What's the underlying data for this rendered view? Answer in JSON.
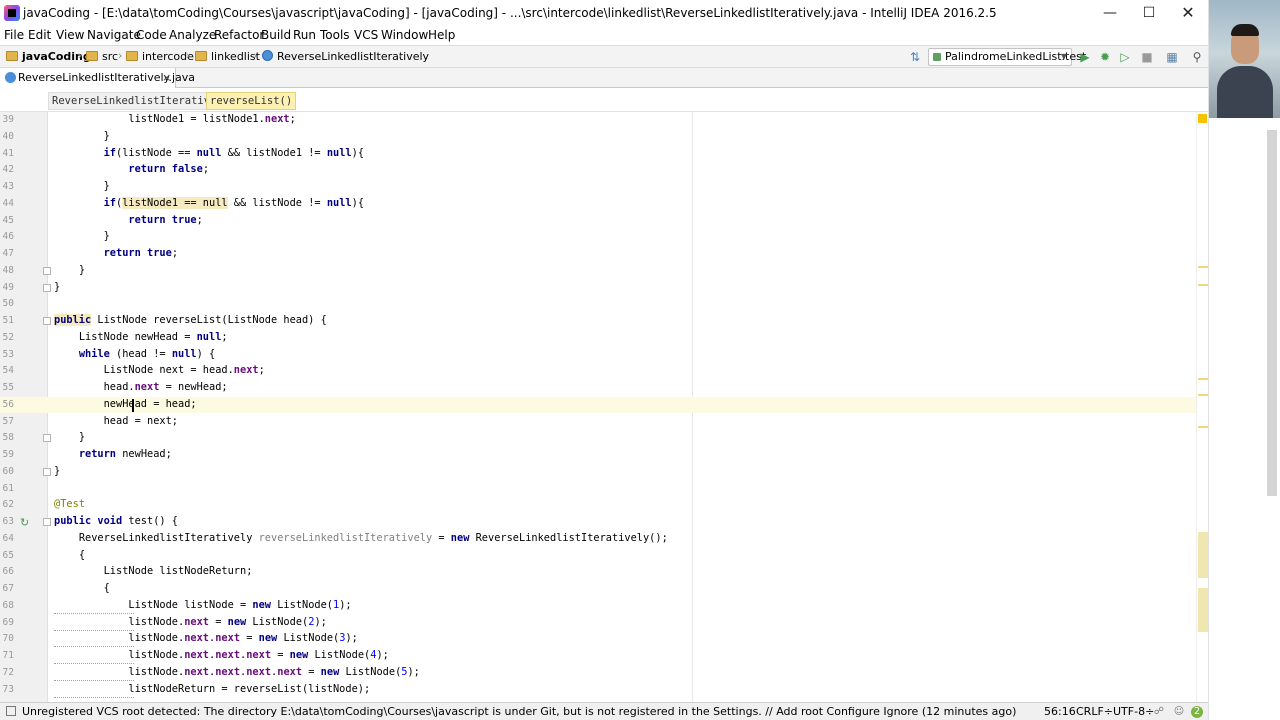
{
  "window": {
    "title": "javaCoding - [E:\\data\\tomCoding\\Courses\\javascript\\javaCoding] - [javaCoding] - ...\\src\\intercode\\linkedlist\\ReverseLinkedlistIteratively.java - IntelliJ IDEA 2016.2.5"
  },
  "menu": [
    "File",
    "Edit",
    "View",
    "Navigate",
    "Code",
    "Analyze",
    "Refactor",
    "Build",
    "Run",
    "Tools",
    "VCS",
    "Window",
    "Help"
  ],
  "nav": {
    "project": "javaCoding",
    "crumbs": [
      "src",
      "intercode",
      "linkedlist",
      "ReverseLinkedlistIteratively"
    ],
    "run_config": "PalindromeLinkedList.test"
  },
  "tabs": [
    {
      "label": "ReverseLinkedlistIteratively.java",
      "close": "×"
    }
  ],
  "breadcrumbs": {
    "class": "ReverseLinkedlistIteratively",
    "method": "reverseList()"
  },
  "lines": [
    {
      "n": "39",
      "indent": "            ",
      "segs": [
        [
          "t",
          "listNode1 = listNode1."
        ],
        [
          "f",
          "next"
        ],
        [
          "t",
          ";"
        ]
      ]
    },
    {
      "n": "40",
      "indent": "        ",
      "segs": [
        [
          "t",
          "}"
        ]
      ]
    },
    {
      "n": "41",
      "indent": "        ",
      "segs": [
        [
          "k",
          "if"
        ],
        [
          "t",
          "(listNode == "
        ],
        [
          "k",
          "null"
        ],
        [
          "t",
          " && listNode1 != "
        ],
        [
          "k",
          "null"
        ],
        [
          "t",
          "){"
        ]
      ]
    },
    {
      "n": "42",
      "indent": "            ",
      "segs": [
        [
          "k",
          "return false"
        ],
        [
          "t",
          ";"
        ]
      ]
    },
    {
      "n": "43",
      "indent": "        ",
      "segs": [
        [
          "t",
          "}"
        ]
      ]
    },
    {
      "n": "44",
      "indent": "        ",
      "segs": [
        [
          "k",
          "if"
        ],
        [
          "t",
          "("
        ],
        [
          "h",
          "listNode1 == null"
        ],
        [
          "t",
          " && listNode != "
        ],
        [
          "k",
          "null"
        ],
        [
          "t",
          "){"
        ]
      ]
    },
    {
      "n": "45",
      "indent": "            ",
      "segs": [
        [
          "k",
          "return true"
        ],
        [
          "t",
          ";"
        ]
      ]
    },
    {
      "n": "46",
      "indent": "        ",
      "segs": [
        [
          "t",
          "}"
        ]
      ]
    },
    {
      "n": "47",
      "indent": "        ",
      "segs": [
        [
          "k",
          "return true"
        ],
        [
          "t",
          ";"
        ]
      ]
    },
    {
      "n": "48",
      "indent": "    ",
      "segs": [
        [
          "t",
          "}"
        ]
      ]
    },
    {
      "n": "49",
      "indent": "",
      "segs": [
        [
          "t",
          "}"
        ]
      ]
    },
    {
      "n": "50",
      "indent": "",
      "segs": []
    },
    {
      "n": "51",
      "indent": "",
      "segs": [
        [
          "hk",
          "public"
        ],
        [
          "t",
          " ListNode reverseList(ListNode head) {"
        ]
      ]
    },
    {
      "n": "52",
      "indent": "    ",
      "segs": [
        [
          "t",
          "ListNode newHead = "
        ],
        [
          "k",
          "null"
        ],
        [
          "t",
          ";"
        ]
      ]
    },
    {
      "n": "53",
      "indent": "    ",
      "segs": [
        [
          "k",
          "while"
        ],
        [
          "t",
          " (head != "
        ],
        [
          "k",
          "null"
        ],
        [
          "t",
          ") {"
        ]
      ]
    },
    {
      "n": "54",
      "indent": "        ",
      "segs": [
        [
          "t",
          "ListNode next = head."
        ],
        [
          "f",
          "next"
        ],
        [
          "t",
          ";"
        ]
      ]
    },
    {
      "n": "55",
      "indent": "        ",
      "segs": [
        [
          "t",
          "head."
        ],
        [
          "f",
          "next"
        ],
        [
          "t",
          " = newHead;"
        ]
      ]
    },
    {
      "n": "56",
      "indent": "        ",
      "segs": [
        [
          "t",
          "newHead = head;"
        ]
      ]
    },
    {
      "n": "57",
      "indent": "        ",
      "segs": [
        [
          "t",
          "head = next;"
        ]
      ]
    },
    {
      "n": "58",
      "indent": "    ",
      "segs": [
        [
          "t",
          "}"
        ]
      ]
    },
    {
      "n": "59",
      "indent": "    ",
      "segs": [
        [
          "k",
          "return"
        ],
        [
          "t",
          " newHead;"
        ]
      ]
    },
    {
      "n": "60",
      "indent": "",
      "segs": [
        [
          "t",
          "}"
        ]
      ]
    },
    {
      "n": "61",
      "indent": "",
      "segs": []
    },
    {
      "n": "62",
      "indent": "",
      "segs": [
        [
          "a",
          "@Test"
        ]
      ]
    },
    {
      "n": "63",
      "indent": "",
      "segs": [
        [
          "k",
          "public void"
        ],
        [
          "t",
          " test() {"
        ]
      ]
    },
    {
      "n": "64",
      "indent": "    ",
      "segs": [
        [
          "t",
          "ReverseLinkedlistIteratively "
        ],
        [
          "u",
          "reverseLinkedlistIteratively"
        ],
        [
          "t",
          " = "
        ],
        [
          "k",
          "new"
        ],
        [
          "t",
          " ReverseLinkedlistIteratively();"
        ]
      ]
    },
    {
      "n": "65",
      "indent": "    ",
      "segs": [
        [
          "t",
          "{"
        ]
      ]
    },
    {
      "n": "66",
      "indent": "        ",
      "segs": [
        [
          "t",
          "ListNode listNodeReturn;"
        ]
      ]
    },
    {
      "n": "67",
      "indent": "        ",
      "segs": [
        [
          "t",
          "{"
        ]
      ]
    },
    {
      "n": "68",
      "indent": "            ",
      "segs": [
        [
          "t",
          "ListNode listNode = "
        ],
        [
          "k",
          "new"
        ],
        [
          "t",
          " ListNode("
        ],
        [
          "n",
          "1"
        ],
        [
          "t",
          ");"
        ]
      ]
    },
    {
      "n": "69",
      "indent": "            ",
      "segs": [
        [
          "t",
          "listNode."
        ],
        [
          "f",
          "next"
        ],
        [
          "t",
          " = "
        ],
        [
          "k",
          "new"
        ],
        [
          "t",
          " ListNode("
        ],
        [
          "n",
          "2"
        ],
        [
          "t",
          ");"
        ]
      ]
    },
    {
      "n": "70",
      "indent": "            ",
      "segs": [
        [
          "t",
          "listNode."
        ],
        [
          "f",
          "next"
        ],
        [
          "t",
          "."
        ],
        [
          "f",
          "next"
        ],
        [
          "t",
          " = "
        ],
        [
          "k",
          "new"
        ],
        [
          "t",
          " ListNode("
        ],
        [
          "n",
          "3"
        ],
        [
          "t",
          ");"
        ]
      ]
    },
    {
      "n": "71",
      "indent": "            ",
      "segs": [
        [
          "t",
          "listNode."
        ],
        [
          "f",
          "next"
        ],
        [
          "t",
          "."
        ],
        [
          "f",
          "next"
        ],
        [
          "t",
          "."
        ],
        [
          "f",
          "next"
        ],
        [
          "t",
          " = "
        ],
        [
          "k",
          "new"
        ],
        [
          "t",
          " ListNode("
        ],
        [
          "n",
          "4"
        ],
        [
          "t",
          ");"
        ]
      ]
    },
    {
      "n": "72",
      "indent": "            ",
      "segs": [
        [
          "t",
          "listNode."
        ],
        [
          "f",
          "next"
        ],
        [
          "t",
          "."
        ],
        [
          "f",
          "next"
        ],
        [
          "t",
          "."
        ],
        [
          "f",
          "next"
        ],
        [
          "t",
          "."
        ],
        [
          "f",
          "next"
        ],
        [
          "t",
          " = "
        ],
        [
          "k",
          "new"
        ],
        [
          "t",
          " ListNode("
        ],
        [
          "n",
          "5"
        ],
        [
          "t",
          ");"
        ]
      ]
    },
    {
      "n": "73",
      "indent": "            ",
      "segs": [
        [
          "t",
          "listNodeReturn = reverseList(listNode);"
        ]
      ]
    }
  ],
  "status": {
    "message": "Unregistered VCS root detected: The directory E:\\data\\tomCoding\\Courses\\javascript is under Git, but is not registered in the Settings. // Add root  Configure  Ignore (12 minutes ago)",
    "position": "56:16",
    "line_sep": "CRLF÷",
    "encoding": "UTF-8÷",
    "badge": "2"
  },
  "icons": {
    "title": "intellij-idea-icon",
    "run": "run-icon",
    "debug": "debug-icon",
    "coverage": "coverage-icon",
    "stop": "stop-icon",
    "structure": "project-structure-icon",
    "search": "search-icon"
  },
  "colors": {
    "keyword": "#000080",
    "field": "#660e7a",
    "number": "#0000ff",
    "annotation": "#808000",
    "current_line": "#fcfae0"
  }
}
